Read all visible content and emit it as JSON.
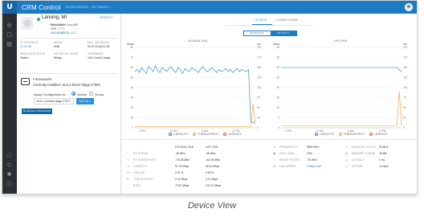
{
  "app": {
    "title": "CRM Control",
    "breadcrumb": "ROCKETBOOK • NETWORK • ..."
  },
  "colors": {
    "accent": "#1d7bc4",
    "capacity": "#1d7bc4",
    "throughput": "#f39c2e",
    "latency": "#e4572e"
  },
  "device": {
    "name": "Lansing, MI",
    "restart_label": "REBOOT",
    "product_label": "PRODUCT",
    "product": "NanoStation Loco M5",
    "type_label": "TYPE",
    "type": "CPE",
    "ap_label": "AP",
    "ap": "WASHINGTON, D.C."
  },
  "info_grid": {
    "ip_label": "IP ADDRESS",
    "ip": "10.0.2.30",
    "mode_label": "MODE",
    "mode": "Multi",
    "mac_label": "MAC ADDRESS",
    "mac": "00:27:22:ab:12:35",
    "wmode_label": "WIRELESS MODE",
    "wmode": "Station",
    "netmode_label": "NETWORK MODE",
    "netmode": "Bridge",
    "firmware_label": "FIRMWARE",
    "firmware": "v5.6.1-beta7-stage"
  },
  "firmware": {
    "title": "FIRMWARE",
    "current": "Currently Installed: v5.6.1-beta7-stage.27593",
    "apply_label": "Apply Configuration to:",
    "opt_device": "Device",
    "opt_group": "Group",
    "select_value": "v5.6.1-d-beta2-stage.27977",
    "install_label": "INSTALL",
    "manage_label": "MANAGE FIRMWARE"
  },
  "tabs": [
    {
      "label": "STATS"
    },
    {
      "label": "CONFIGURE"
    }
  ],
  "segmented": [
    {
      "label": "WIRELESS"
    },
    {
      "label": "ACTIVITY"
    }
  ],
  "legend": {
    "capacity": "CAPACITY",
    "throughput": "THROUGHPUT",
    "latency": "LATENCY"
  },
  "chart_data": [
    {
      "type": "line",
      "title": "DOWNLINK",
      "ylabel": "Mbps",
      "ylabel_right": "ms",
      "ylim": [
        0,
        80
      ],
      "ylim_right": [
        0,
        200
      ],
      "yticks": [
        0,
        10,
        20,
        30,
        40,
        50,
        60,
        70,
        80
      ],
      "yticks_right": [
        0,
        25,
        50,
        75,
        100,
        125,
        150,
        175,
        200
      ],
      "xticks": [
        "6 PM",
        "12 AM",
        "6 AM",
        "12 PM"
      ],
      "series": [
        {
          "name": "CAPACITY",
          "values": [
            56,
            58,
            55,
            60,
            57,
            54,
            61,
            59,
            56,
            62,
            57,
            55,
            60,
            58,
            56,
            59,
            61,
            57,
            55,
            60,
            58,
            54,
            59,
            57,
            56,
            60,
            58,
            57,
            55,
            59,
            61,
            57,
            56,
            58,
            60,
            57,
            55,
            58,
            56,
            57,
            59,
            56,
            58,
            55,
            57,
            59,
            56,
            58,
            57,
            56,
            58,
            6,
            5,
            6
          ]
        },
        {
          "name": "THROUGHPUT",
          "values": [
            1,
            1,
            1,
            1,
            1,
            1,
            1,
            1,
            1,
            1,
            1,
            1,
            1,
            1,
            1,
            1,
            1,
            1,
            1,
            1,
            1,
            1,
            1,
            1,
            1,
            1,
            1,
            1,
            1,
            1,
            1,
            1,
            1,
            1,
            1,
            1,
            1,
            1,
            1,
            1,
            1,
            1,
            1,
            1,
            1,
            1,
            1,
            1,
            1,
            1,
            1,
            1,
            24,
            3
          ]
        }
      ]
    },
    {
      "type": "line",
      "title": "UPLINK",
      "ylabel": "Mbps",
      "ylabel_right": "ms",
      "ylim": [
        0,
        40
      ],
      "ylim_right": [
        0,
        200
      ],
      "yticks": [
        0,
        5,
        10,
        15,
        20,
        25,
        30,
        35,
        40
      ],
      "yticks_right": [
        0,
        25,
        50,
        75,
        100,
        125,
        150,
        175,
        200
      ],
      "xticks": [
        "6 PM",
        "12 AM",
        "6 AM",
        "12 PM"
      ],
      "series": [
        {
          "name": "CAPACITY",
          "values": [
            30,
            30,
            30,
            30,
            30,
            30,
            30,
            30,
            30,
            30,
            30,
            30,
            30,
            30,
            30,
            30,
            30,
            30,
            30,
            30,
            30,
            30,
            30,
            30,
            30,
            30,
            30,
            30,
            30,
            30,
            30,
            30,
            30,
            30,
            30,
            30,
            30,
            30,
            30,
            30,
            30,
            30,
            30,
            30,
            30,
            30,
            30,
            30,
            30,
            30,
            30,
            30,
            29,
            28
          ]
        },
        {
          "name": "THROUGHPUT",
          "values": [
            1,
            1,
            1,
            1,
            1,
            1,
            1,
            1,
            1,
            1,
            1,
            1,
            1,
            1,
            1,
            1,
            1,
            1,
            1,
            1,
            1,
            1,
            1,
            1,
            1,
            1,
            1,
            1,
            1,
            1,
            1,
            1,
            1,
            1,
            1,
            1,
            1,
            1,
            1,
            1,
            1,
            1,
            1,
            1,
            1,
            1,
            1,
            1,
            1,
            1,
            1,
            1,
            18,
            1
          ]
        }
      ]
    }
  ],
  "stats": {
    "downlink_head": "DOWNLINK",
    "uplink_head": "UPLINK",
    "rows": [
      {
        "label": "RX SIGNAL",
        "down": "-48 dBm",
        "up": "-48 dBm"
      },
      {
        "label": "RX NOISE/RATE",
        "down": "-75/-68 dBm",
        "up": "-62/-63 dBm"
      },
      {
        "label": "CAPACITY",
        "down": "57.76 Mbps",
        "up": "68.31 Mbps"
      },
      {
        "label": "LINK QA",
        "down": "0.01 %",
        "up": "0.58 %"
      },
      {
        "label": "THROUGHPUT",
        "down": "0.01 Mbps",
        "up": "0.01 Mbps"
      },
      {
        "label": "RATE",
        "down": "79.87 Mbps",
        "up": "130.12 Mbps"
      }
    ],
    "col3": [
      {
        "label": "FREQUENCY",
        "value": "5800 MHz"
      },
      {
        "label": "CPU LOAD",
        "value": "24%"
      },
      {
        "label": "NOISE FLOOR",
        "value": "-93 dBm"
      },
      {
        "label": "LAN SPEED",
        "value": "0 Mbps Half",
        "link": true
      }
    ],
    "col4": [
      {
        "label": "CHANNEL WIDTH",
        "value": "20 MHz"
      },
      {
        "label": "MEMORY USAGE",
        "value": "28 MB"
      },
      {
        "label": "LATENCY",
        "value": "1 ms"
      },
      {
        "label": "UPTIME",
        "value": "14 days"
      }
    ]
  },
  "caption": "Device View"
}
